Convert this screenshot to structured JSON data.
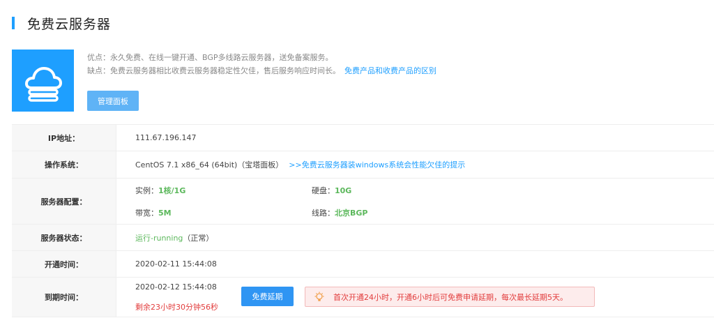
{
  "header": {
    "title": "免费云服务器"
  },
  "intro": {
    "icon": "cloud-server-icon",
    "pros": "优点：永久免费、在线一键开通、BGP多线路云服务器，送免备案服务。",
    "cons": "缺点：免费云服务器相比收费云服务器稳定性欠佳，售后服务响应时间长。",
    "compare_link": "免费产品和收费产品的区别",
    "manage_button": "管理面板"
  },
  "info": {
    "ip": {
      "label": "IP地址：",
      "value": "111.67.196.147"
    },
    "os": {
      "label": "操作系统：",
      "value": "CentOS 7.1 x86_64 (64bit)（宝塔面板）",
      "link": ">>免费云服务器装windows系统会性能欠佳的提示"
    },
    "config": {
      "label": "服务器配置：",
      "instance_key": "实例：",
      "instance_val": "1核/1G",
      "disk_key": "硬盘：",
      "disk_val": "10G",
      "bandwidth_key": "带宽：",
      "bandwidth_val": "5M",
      "line_key": "线路：",
      "line_val": "北京BGP"
    },
    "status": {
      "label": "服务器状态：",
      "value": "运行-running",
      "note": "（正常）"
    },
    "open_time": {
      "label": "开通时间：",
      "value": "2020-02-11 15:44:08"
    },
    "expire": {
      "label": "到期时间：",
      "value": "2020-02-12 15:44:08",
      "remaining": "剩余23小时30分钟56秒",
      "extend_button": "免费延期",
      "notice": "首次开通24小时，开通6小时后可免费申请延期，每次最长延期5天。"
    }
  },
  "colors": {
    "accent": "#1e9fff",
    "green": "#5cb85c",
    "red": "#e23d3d"
  }
}
